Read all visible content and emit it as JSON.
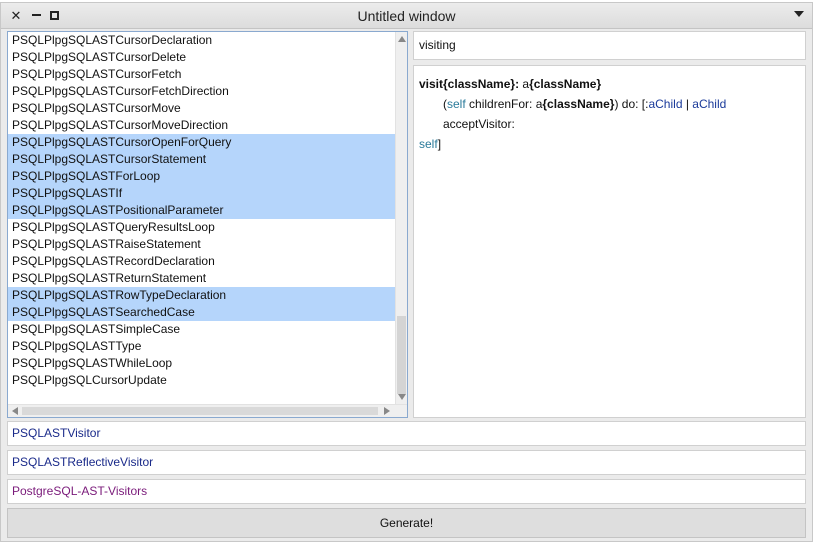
{
  "window": {
    "title": "Untitled window"
  },
  "class_list": {
    "items": [
      {
        "label": "PSQLPlpgSQLASTCursorDeclaration",
        "selected": false
      },
      {
        "label": "PSQLPlpgSQLASTCursorDelete",
        "selected": false
      },
      {
        "label": "PSQLPlpgSQLASTCursorFetch",
        "selected": false
      },
      {
        "label": "PSQLPlpgSQLASTCursorFetchDirection",
        "selected": false
      },
      {
        "label": "PSQLPlpgSQLASTCursorMove",
        "selected": false
      },
      {
        "label": "PSQLPlpgSQLASTCursorMoveDirection",
        "selected": false
      },
      {
        "label": "PSQLPlpgSQLASTCursorOpenForQuery",
        "selected": true
      },
      {
        "label": "PSQLPlpgSQLASTCursorStatement",
        "selected": true
      },
      {
        "label": "PSQLPlpgSQLASTForLoop",
        "selected": true
      },
      {
        "label": "PSQLPlpgSQLASTIf",
        "selected": true
      },
      {
        "label": "PSQLPlpgSQLASTPositionalParameter",
        "selected": true
      },
      {
        "label": "PSQLPlpgSQLASTQueryResultsLoop",
        "selected": false
      },
      {
        "label": "PSQLPlpgSQLASTRaiseStatement",
        "selected": false
      },
      {
        "label": "PSQLPlpgSQLASTRecordDeclaration",
        "selected": false
      },
      {
        "label": "PSQLPlpgSQLASTReturnStatement",
        "selected": false
      },
      {
        "label": "PSQLPlpgSQLASTRowTypeDeclaration",
        "selected": true
      },
      {
        "label": "PSQLPlpgSQLASTSearchedCase",
        "selected": true
      },
      {
        "label": "PSQLPlpgSQLASTSimpleCase",
        "selected": false
      },
      {
        "label": "PSQLPlpgSQLASTType",
        "selected": false
      },
      {
        "label": "PSQLPlpgSQLASTWhileLoop",
        "selected": false
      },
      {
        "label": "PSQLPlpgSQLCursorUpdate",
        "selected": false
      }
    ]
  },
  "protocol": {
    "value": "visiting"
  },
  "code": {
    "line1_selector": "visit{className}:",
    "line1_arg_prefix": " a",
    "line1_arg_bold": "{className}",
    "line2_open": "(",
    "line2_self": "self",
    "line2_msg": " childrenFor: a",
    "line2_bold": "{className}",
    "line2_do": ") do: [:",
    "line2_block_arg": "aChild",
    "line2_bar": " | ",
    "line2_block_var": "aChild",
    "line2_accept": " acceptVisitor:",
    "line3_self": "self",
    "line3_close": "]"
  },
  "fields": {
    "visitor_class": "PSQLASTVisitor",
    "reflective_visitor_class": "PSQLASTReflectiveVisitor",
    "package": "PostgreSQL-AST-Visitors"
  },
  "generate_button": {
    "label": "Generate!"
  },
  "colors": {
    "selection": "#b5d5fb",
    "class_name": "#1a2a8a",
    "package_name": "#7a1a7a",
    "keyword": "#2a7a9a"
  }
}
